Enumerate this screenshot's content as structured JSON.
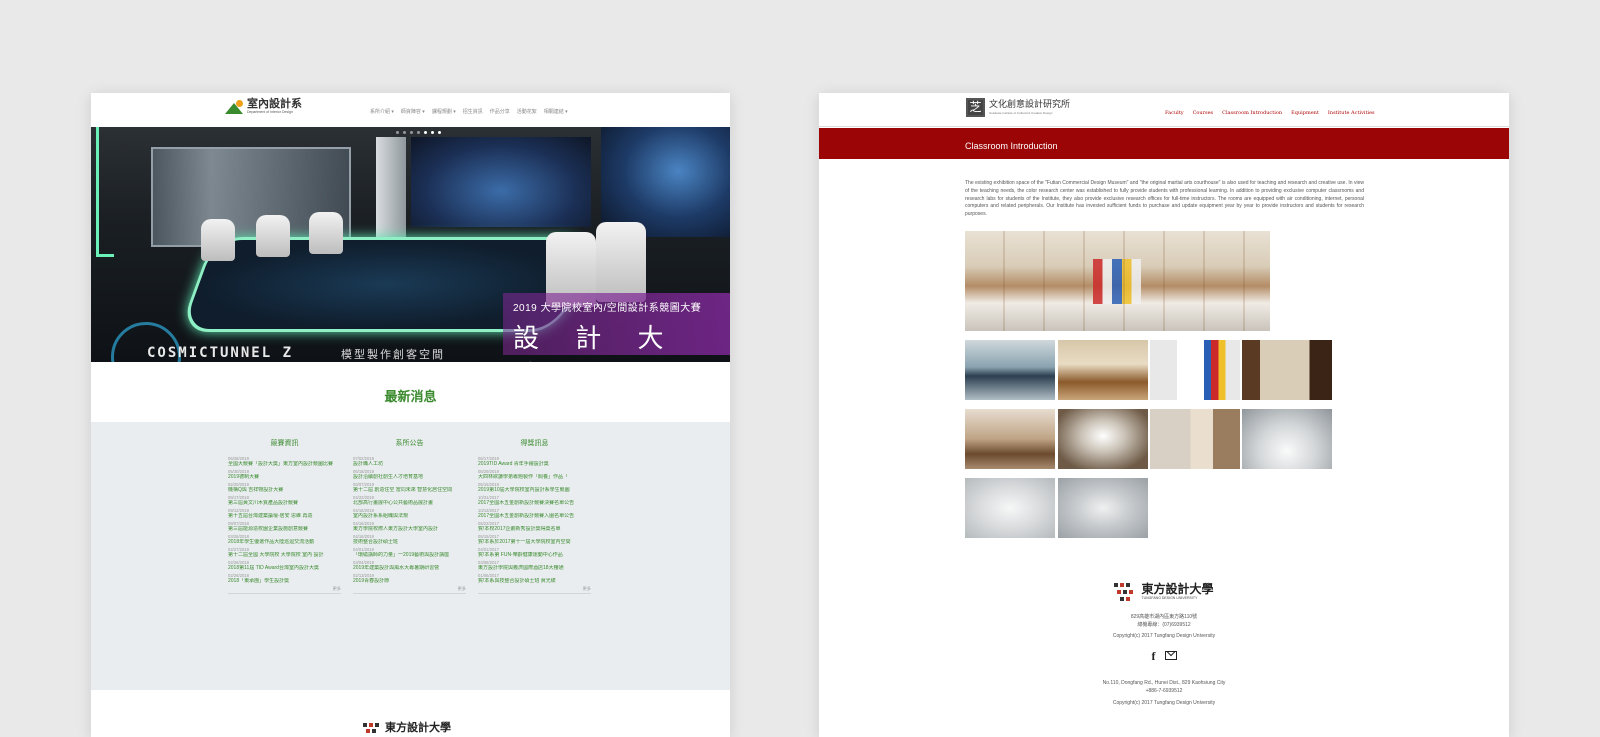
{
  "left_site": {
    "logo": {
      "title": "室內設計系",
      "subtitle": "Department of Interior Design"
    },
    "nav": [
      "系所介紹 ▾",
      "師資陣容 ▾",
      "課程規劃 ▾",
      "招生資訊",
      "作品分享",
      "活動花絮",
      "相關連結 ▾"
    ],
    "hero": {
      "banner_line1": "2019 大學院校室內/空間設計系競圖大賽",
      "banner_line2": "設 計 大 獎",
      "neon_text": "COSMICTUNNEL Z",
      "neon_text_cn": "模型製作創客空間"
    },
    "news_title": "最新消息",
    "columns": [
      {
        "heading": "競賽資訊",
        "items": [
          {
            "date": "06/28/2019",
            "text": "全國大競賽「設計大獎」東方室內設計競圖比賽"
          },
          {
            "date": "05/30/2019",
            "text": "2019德制大賽"
          },
          {
            "date": "02/20/2019",
            "text": "機構Q與 吉祥物設計大賽"
          },
          {
            "date": "09/17/2018",
            "text": "第三屆黃文川木質產品設計競賽"
          },
          {
            "date": "09/12/2018",
            "text": "第十五屆台灣建築論壇-居安 思維 再造"
          },
          {
            "date": "09/07/2018",
            "text": "第三屆能源造校園企業設施創意競賽"
          },
          {
            "date": "03/26/2018",
            "text": "2018年學生優選作品大陸巡迴交流活動"
          },
          {
            "date": "02/27/2018",
            "text": "第十二屆全國 大學院校 大學院校 室內 設計"
          },
          {
            "date": "02/26/2018",
            "text": "2018第11屆 TID Award台灣室內設計大獎"
          },
          {
            "date": "02/26/2018",
            "text": "2018「東承團」學生設計獎"
          }
        ],
        "more": "更多"
      },
      {
        "heading": "系所公告",
        "items": [
          {
            "date": "07/02/2019",
            "text": "設計職人工坊"
          },
          {
            "date": "06/18/2019",
            "text": "設計沿續創社創生人才培育基地"
          },
          {
            "date": "05/07/2019",
            "text": "第十二屆 創造住空 當同未來 智慧化居住空間"
          },
          {
            "date": "04/22/2019",
            "text": "北部高行畫展中心公共藝術品展計畫"
          },
          {
            "date": "04/16/2019",
            "text": "室內設計系系組織與法規"
          },
          {
            "date": "04/16/2019",
            "text": "東方學院校際人東方設計大學室內設計"
          },
          {
            "date": "04/16/2019",
            "text": "技術整合設計碩士班"
          },
          {
            "date": "04/01/2019",
            "text": "「環繞講師的力量」一2019藝術與設計講座"
          },
          {
            "date": "03/04/2019",
            "text": "2019年建築設計與風水大專暑期研習營"
          },
          {
            "date": "02/13/2019",
            "text": "2019青春設計節"
          }
        ],
        "more": "更多"
      },
      {
        "heading": "得獎訊息",
        "items": [
          {
            "date": "06/17/2019",
            "text": "2019TID Award 青年手繪設計獎"
          },
          {
            "date": "05/29/2019",
            "text": "大四林欲謙學弟專題製作「飼養」作品「"
          },
          {
            "date": "05/15/2019",
            "text": "2019第10屆大學院校室內設計系學生競圖"
          },
          {
            "date": "10/31/2017",
            "text": "2017全國木五金創新設計競賽決賽名單公告"
          },
          {
            "date": "10/13/2017",
            "text": "2017全國木五金創新設計競賽入圍名單公告"
          },
          {
            "date": "05/22/2017",
            "text": "賀!本校2017企劃新秀設計獎得獎名單"
          },
          {
            "date": "05/15/2017",
            "text": "賀!本系於2017第十一屆大學院校室內空間"
          },
          {
            "date": "04/01/2017",
            "text": "賀!本系第 FUN-樂齡健康運動中心作品"
          },
          {
            "date": "03/08/2017",
            "text": "東方設計學院與義濟國際酒店18大樓通"
          },
          {
            "date": "01/06/2017",
            "text": "賀!本系與技整合設計碩士班 眞光碟"
          }
        ],
        "more": "更多"
      }
    ],
    "footer_logo": "東方設計大學"
  },
  "right_site": {
    "logo": {
      "mark": "芝",
      "title": "文化創意設計研究所",
      "subtitle": "Graduate Institute of Cultural & Creative Design"
    },
    "nav": [
      "Faculty",
      "Courses",
      "Classroom Introduction",
      "Equipment",
      "Institute Activities"
    ],
    "section_title": "Classroom Introduction",
    "paragraph": "The existing exhibition space of the \"Futian Commercial Design Museum\" and \"the original martial arts courthouse\" is also used for teaching and research and creative use. In view of the teaching needs, the color research center was established to fully provide students with professional learning. In addition to providing exclusive computer classrooms and research labs for students of the Institute, they also provide exclusive research offices for full-time instructors. The rooms are equipped with air conditioning, internet, personal computers and related peripherals. Our Institute has invested sufficient funds to purchase and update equipment year by year to provide instructors and students for research purposes.",
    "footer": {
      "logo_cn": "東方設計大學",
      "logo_en": "TUNGFANG DESIGN UNIVERSITY",
      "address_cn": "829高雄市湖內區東方路110號",
      "phone_cn": "總機專線：(07)6939512",
      "copyright": "Copyright(c) 2017 Tungfang Design University",
      "address_en": "No.110, Dongfang Rd., Hunei Dist., 829 Kaohsiung City",
      "phone_en": "+886-7-6939512",
      "copyright2": "Copyright(c) 2017 Tungfang Design University"
    }
  },
  "colors": {
    "left_accent": "#3a8a2e",
    "right_accent": "#9b0505",
    "banner_purple": "#7d2896"
  }
}
